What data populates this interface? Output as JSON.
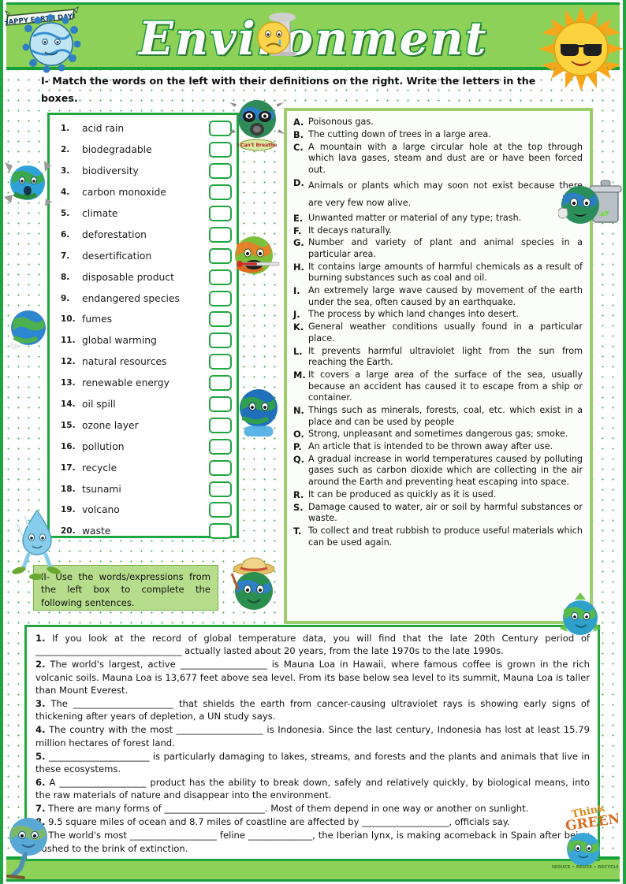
{
  "header": {
    "title": "Environment",
    "earthday_banner_text": "HAPPY EARTH DAY!"
  },
  "instructions": {
    "part1": "I- Match the words on the left with their definitions on the right. Write the letters in the boxes.",
    "part2": "II- Use the words/expressions from the left box to complete the following sentences."
  },
  "words": [
    {
      "num": "1.",
      "label": "acid rain",
      "answer": ""
    },
    {
      "num": "2.",
      "label": "biodegradable",
      "answer": ""
    },
    {
      "num": "3.",
      "label": "biodiversity",
      "answer": ""
    },
    {
      "num": "4.",
      "label": "carbon monoxide",
      "answer": ""
    },
    {
      "num": "5.",
      "label": "climate",
      "answer": ""
    },
    {
      "num": "6.",
      "label": "deforestation",
      "answer": ""
    },
    {
      "num": "7.",
      "label": "desertification",
      "answer": ""
    },
    {
      "num": "8.",
      "label": "disposable product",
      "answer": ""
    },
    {
      "num": "9.",
      "label": "endangered species",
      "answer": ""
    },
    {
      "num": "10.",
      "label": "fumes",
      "answer": ""
    },
    {
      "num": "11.",
      "label": "global warming",
      "answer": ""
    },
    {
      "num": "12.",
      "label": "natural resources",
      "answer": ""
    },
    {
      "num": "13.",
      "label": "renewable energy",
      "answer": ""
    },
    {
      "num": "14.",
      "label": "oil spill",
      "answer": ""
    },
    {
      "num": "15.",
      "label": "ozone layer",
      "answer": ""
    },
    {
      "num": "16.",
      "label": "pollution",
      "answer": ""
    },
    {
      "num": "17.",
      "label": "recycle",
      "answer": ""
    },
    {
      "num": "18.",
      "label": "tsunami",
      "answer": ""
    },
    {
      "num": "19.",
      "label": "volcano",
      "answer": ""
    },
    {
      "num": "20.",
      "label": "waste",
      "answer": ""
    }
  ],
  "definitions": [
    {
      "letter": "A.",
      "text": "Poisonous gas."
    },
    {
      "letter": "B.",
      "text": "The cutting down of trees in a large area."
    },
    {
      "letter": "C.",
      "text": "A mountain with a large circular hole at the top through which lava gases, steam and dust are or have been forced out."
    },
    {
      "letter": "D.",
      "text": "Animals or plants which may soon not exist because there are very few now alive."
    },
    {
      "letter": "E.",
      "text": "Unwanted matter or material of any type; trash."
    },
    {
      "letter": "F.",
      "text": "It decays naturally."
    },
    {
      "letter": "G.",
      "text": "Number and variety of plant and animal species in a particular area."
    },
    {
      "letter": "H.",
      "text": "It contains large amounts of harmful chemicals as a result of burning substances such as coal and oil."
    },
    {
      "letter": "I.",
      "text": "An extremely large wave caused by movement of the earth under the sea, often caused by an earthquake."
    },
    {
      "letter": "J.",
      "text": "The process by which land changes into desert."
    },
    {
      "letter": "K.",
      "text": "General weather conditions usually found in a particular place."
    },
    {
      "letter": "L.",
      "text": "It prevents harmful ultraviolet light from the sun from reaching the Earth."
    },
    {
      "letter": "M.",
      "text": "It covers a large area of the surface of the sea, usually because an accident has caused it to escape from a ship or container."
    },
    {
      "letter": "N.",
      "text": "Things such as minerals, forests, coal, etc. which exist in a place and can be used by people"
    },
    {
      "letter": "O.",
      "text": "Strong, unpleasant and sometimes dangerous gas; smoke."
    },
    {
      "letter": "P.",
      "text": "An article that is intended to be thrown away after use."
    },
    {
      "letter": "Q.",
      "text": "A gradual increase in world temperatures caused by polluting gases such as carbon dioxide which are collecting in the air around the Earth and preventing heat escaping into space."
    },
    {
      "letter": "R.",
      "text": "It can be produced as quickly as it is used."
    },
    {
      "letter": "S.",
      "text": "Damage caused to water, air or soil by harmful substances or waste."
    },
    {
      "letter": "T.",
      "text": "To collect and treat rubbish to produce useful materials which can be used again."
    }
  ],
  "sentences": [
    {
      "num": "1.",
      "text": "If you look at the record of global temperature data, you will find that the late 20th Century period of ________________________________ actually lasted about 20 years, from the late 1970s to the late 1990s."
    },
    {
      "num": "2.",
      "text": "The world's largest, active ___________________ is Mauna Loa in Hawaii, where famous coffee is grown in the rich volcanic soils. Mauna Loa is 13,677 feet above sea level. From its base below sea level to its summit, Mauna Loa is taller than Mount Everest."
    },
    {
      "num": "3.",
      "text": "The ______________________ that shields the earth from cancer-causing ultraviolet rays is showing early signs of thickening after years of depletion, a UN study says."
    },
    {
      "num": "4.",
      "text": "The country with the most ___________________ is Indonesia. Since the last century, Indonesia has lost at least 15.79 million hectares of forest land."
    },
    {
      "num": "5.",
      "text": "______________________ is particularly damaging to lakes, streams, and forests and the plants and animals that live in these ecosystems."
    },
    {
      "num": "6.",
      "text": "A ___________________ product has the ability to break down, safely and relatively quickly, by biological means, into the raw materials of nature and disappear into the environment."
    },
    {
      "num": "7.",
      "text": "There are many forms of ______________________. Most of them depend in one way or another on sunlight."
    },
    {
      "num": "8.",
      "text": "9.5 square miles of ocean and 8.7 miles of coastline are affected by ___________________, officials say."
    },
    {
      "num": "9.",
      "text": "The world's most ___________________ feline ______________, the Iberian lynx, is making a",
      "cont": "comeback in Spain after being pushed to the brink of extinction."
    }
  ],
  "clipart": [
    {
      "name": "earth-day-banner",
      "alt": "Happy Earth Day banner ribbon"
    },
    {
      "name": "blue-globe-character",
      "alt": "Blue decorated globe character"
    },
    {
      "name": "crying-smiley-factory",
      "alt": "Sad crying smiley with smokestack"
    },
    {
      "name": "sun-sunglasses",
      "alt": "Cartoon sun wearing sunglasses"
    },
    {
      "name": "globe-gas-mask",
      "alt": "Globe character wearing a gas mask"
    },
    {
      "name": "globe-cracked",
      "alt": "Cracked globe breaking apart"
    },
    {
      "name": "globe-thermometer",
      "alt": "Feverish globe with thermometer"
    },
    {
      "name": "globe-trash-can",
      "alt": "Globe character with trash can, thumbs up"
    },
    {
      "name": "globe-melting",
      "alt": "Melting globe character"
    },
    {
      "name": "water-droplet",
      "alt": "Blue water droplet character with sprouts"
    },
    {
      "name": "globe-hat-painter",
      "alt": "Globe character with straw hat"
    },
    {
      "name": "globe-earth-colorful",
      "alt": "Colorful earth globe"
    },
    {
      "name": "globe-recycle",
      "alt": "Globe character with recycle arrows"
    },
    {
      "name": "globe-skating",
      "alt": "Globe character skating"
    },
    {
      "name": "think-green-logo",
      "alt": "Think Green logo with globe"
    }
  ],
  "colors": {
    "banner_green": "#8dd159",
    "border_green": "#1fa63f",
    "defs_border_green": "#9ccf6b",
    "instr2_fill": "#b6dd8c",
    "dot_green": "#3faa4a",
    "text_dark": "#141414"
  }
}
